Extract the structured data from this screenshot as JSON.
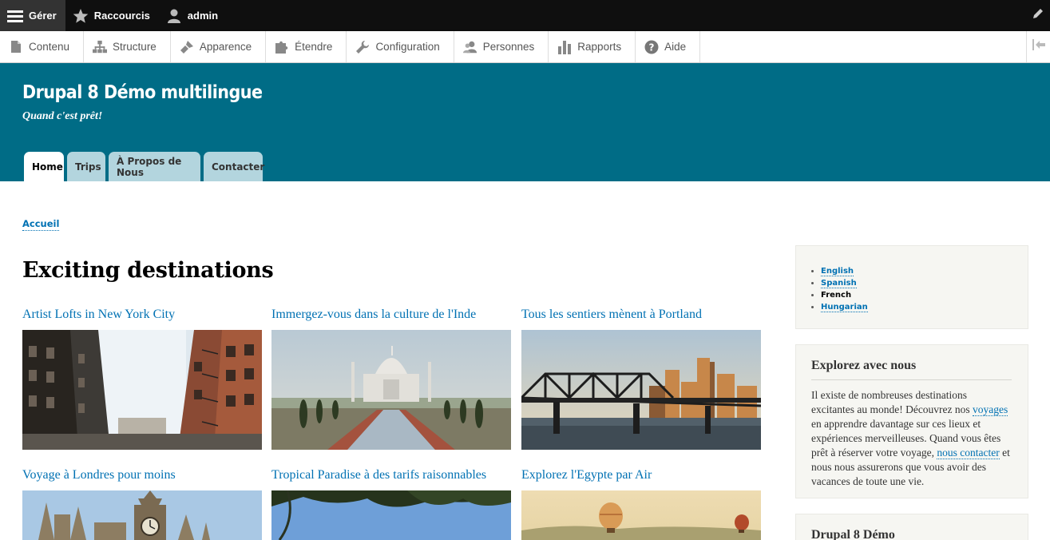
{
  "toolbar": {
    "manage_label": "Gérer",
    "shortcuts_label": "Raccourcis",
    "user_label": "admin"
  },
  "tray": {
    "items": [
      {
        "label": "Contenu",
        "icon": "file-icon"
      },
      {
        "label": "Structure",
        "icon": "sitemap-icon"
      },
      {
        "label": "Apparence",
        "icon": "paintbrush-icon"
      },
      {
        "label": "Étendre",
        "icon": "puzzle-icon"
      },
      {
        "label": "Configuration",
        "icon": "wrench-icon"
      },
      {
        "label": "Personnes",
        "icon": "people-icon"
      },
      {
        "label": "Rapports",
        "icon": "bar-chart-icon"
      },
      {
        "label": "Aide",
        "icon": "help-icon"
      }
    ]
  },
  "header": {
    "site_name": "Drupal 8 Démo multilingue",
    "slogan": "Quand c'est prêt!",
    "tabs": [
      "Home",
      "Trips",
      "À Propos de Nous",
      "Contacter"
    ]
  },
  "breadcrumb": "Accueil",
  "main": {
    "title": "Exciting destinations",
    "cards": [
      {
        "title": "Artist Lofts in New York City"
      },
      {
        "title": "Immergez-vous dans la culture de l'Inde"
      },
      {
        "title": "Tous les sentiers mènent à Portland"
      },
      {
        "title": "Voyage à Londres pour moins"
      },
      {
        "title": "Tropical Paradise à des tarifs raisonnables"
      },
      {
        "title": "Explorez l'Egypte par Air"
      }
    ]
  },
  "sidebar": {
    "languages": [
      "English",
      "Spanish",
      "French",
      "Hungarian"
    ],
    "explore": {
      "title": "Explorez avec nous",
      "text_1": "Il existe de nombreuses destinations excitantes au monde! Découvrez nos ",
      "link_1": "voyages",
      "text_2": " en apprendre davantage sur ces lieux et expériences merveilleuses. Quand vous êtes prêt à réserver votre voyage, ",
      "link_2": "nous contacter",
      "text_3": " et nous nous assurerons que vous avoir des vacances de toute une vie."
    },
    "demo_block_title": "Drupal 8 Démo"
  },
  "colors": {
    "header_bg": "#006c86",
    "link": "#0071b3",
    "tab_bg": "#b3d5de"
  }
}
